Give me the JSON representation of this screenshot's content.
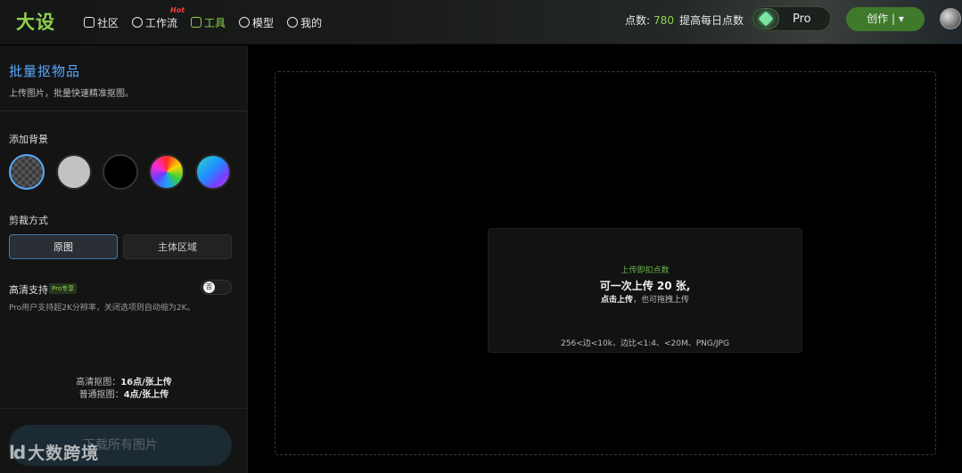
{
  "app": {
    "logo_text": "大设"
  },
  "nav": {
    "items": [
      {
        "label": "社区",
        "icon": "community-icon"
      },
      {
        "label": "工作流",
        "icon": "workflow-icon",
        "badge": "Hot"
      },
      {
        "label": "工具",
        "icon": "tools-icon",
        "active": true
      },
      {
        "label": "模型",
        "icon": "model-icon"
      },
      {
        "label": "我的",
        "icon": "profile-icon"
      }
    ]
  },
  "header": {
    "points_label": "点数:",
    "points_value": "780",
    "raise_daily_label": "提高每日点数",
    "pro_label": "Pro",
    "create_label": "创作 | ▾",
    "accent_color": "#8fd14f"
  },
  "sidebar": {
    "title": "批量抠物品",
    "subtitle": "上传图片，批量快速精准抠图。",
    "background_label": "添加背景",
    "backgrounds": [
      {
        "name": "transparent",
        "selected": true
      },
      {
        "name": "gray"
      },
      {
        "name": "black"
      },
      {
        "name": "rainbow"
      },
      {
        "name": "gradient"
      }
    ],
    "crop_label": "剪裁方式",
    "crop_options": [
      "原图",
      "主体区域"
    ],
    "crop_selected": "原图",
    "hd_label": "高清支持",
    "hd_tag": "Pro专享",
    "hd_toggle_text": "否",
    "hd_desc": "Pro用户支持超2K分辨率，关闭选项则自动缩为2K。",
    "cost_hd": "高清抠图：",
    "cost_hd_value": "16点/张上传",
    "cost_normal": "普通抠图：",
    "cost_normal_value": "4点/张上传",
    "download_label": "下载所有图片"
  },
  "watermark": {
    "mark": "ld",
    "text": "大数跨境"
  },
  "upload": {
    "line1": "上传即扣点数",
    "line2": "可一次上传 20 张,",
    "line3_bold": "点击上传",
    "line3_rest": "，也可拖拽上传",
    "line4": "256<边<10k、边比<1:4、<20M、PNG/JPG"
  }
}
